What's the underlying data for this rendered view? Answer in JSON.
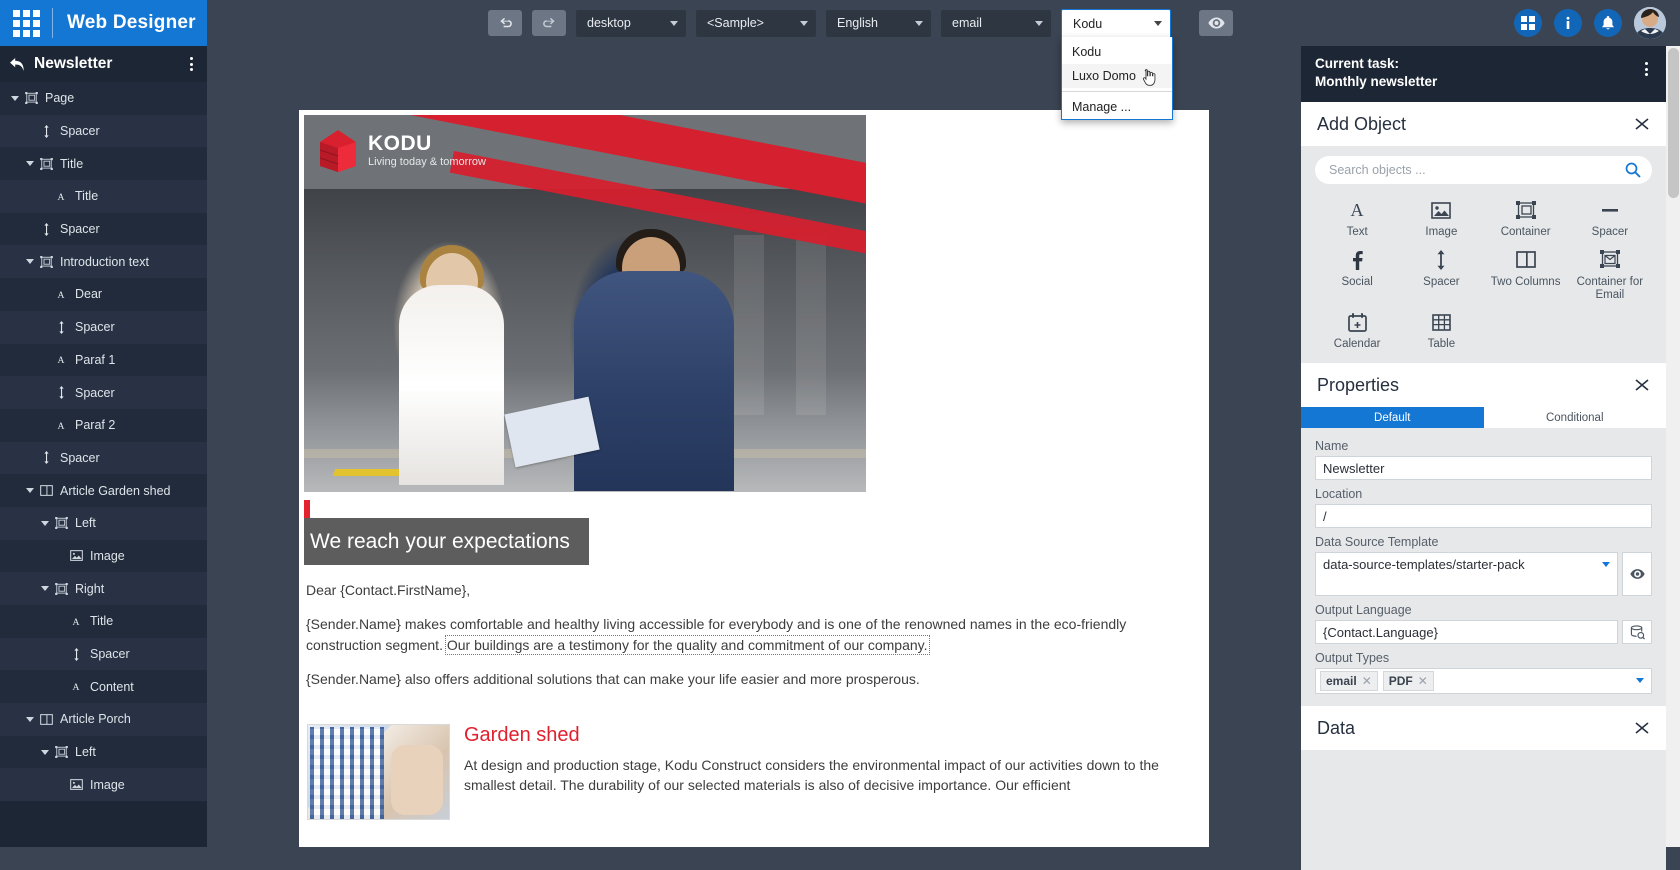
{
  "app": {
    "brand_title": "Web Designer",
    "waffle_icon": "apps-grid-icon",
    "header_icons": [
      "apps-icon",
      "info-icon",
      "notifications-bell-icon",
      "user-avatar"
    ]
  },
  "toolbar": {
    "undo_icon": "undo-icon",
    "redo_icon": "redo-icon",
    "device": {
      "label": "desktop",
      "icon": "chevron-down-icon"
    },
    "sample": {
      "label": "<Sample>",
      "icon": "chevron-down-icon"
    },
    "language": {
      "label": "English",
      "icon": "chevron-down-icon"
    },
    "output": {
      "label": "email",
      "icon": "chevron-down-icon"
    },
    "brand_select": {
      "label": "Kodu",
      "open": true,
      "items": [
        {
          "label": "Kodu",
          "hover": false
        },
        {
          "label": "Luxo Domo",
          "hover": true
        },
        {
          "label": "Manage ...",
          "hover": false
        }
      ]
    },
    "preview_icon": "eye-icon"
  },
  "left_panel": {
    "back_icon": "back-arrow-icon",
    "title": "Newsletter",
    "kebab_icon": "more-vertical-icon",
    "tree": [
      {
        "label": "Page",
        "indent": 0,
        "icon": "container-icon",
        "expandable": true
      },
      {
        "label": "Spacer",
        "indent": 1,
        "icon": "spacer-icon",
        "expandable": false
      },
      {
        "label": "Title",
        "indent": 1,
        "icon": "container-icon",
        "expandable": true
      },
      {
        "label": "Title",
        "indent": 2,
        "icon": "text-icon",
        "expandable": false
      },
      {
        "label": "Spacer",
        "indent": 1,
        "icon": "spacer-icon",
        "expandable": false
      },
      {
        "label": "Introduction text",
        "indent": 1,
        "icon": "container-icon",
        "expandable": true
      },
      {
        "label": "Dear",
        "indent": 2,
        "icon": "text-icon",
        "expandable": false
      },
      {
        "label": "Spacer",
        "indent": 2,
        "icon": "spacer-icon",
        "expandable": false
      },
      {
        "label": "Paraf 1",
        "indent": 2,
        "icon": "text-icon",
        "expandable": false
      },
      {
        "label": "Spacer",
        "indent": 2,
        "icon": "spacer-icon",
        "expandable": false
      },
      {
        "label": "Paraf 2",
        "indent": 2,
        "icon": "text-icon",
        "expandable": false
      },
      {
        "label": "Spacer",
        "indent": 1,
        "icon": "spacer-icon",
        "expandable": false
      },
      {
        "label": "Article Garden shed",
        "indent": 1,
        "icon": "two-columns-icon",
        "expandable": true
      },
      {
        "label": "Left",
        "indent": 2,
        "icon": "container-icon",
        "expandable": true
      },
      {
        "label": "Image",
        "indent": 3,
        "icon": "image-icon",
        "expandable": false
      },
      {
        "label": "Right",
        "indent": 2,
        "icon": "container-icon",
        "expandable": true
      },
      {
        "label": "Title",
        "indent": 3,
        "icon": "text-icon",
        "expandable": false
      },
      {
        "label": "Spacer",
        "indent": 3,
        "icon": "spacer-icon",
        "expandable": false
      },
      {
        "label": "Content",
        "indent": 3,
        "icon": "text-icon",
        "expandable": false
      },
      {
        "label": "Article Porch",
        "indent": 1,
        "icon": "two-columns-icon",
        "expandable": true
      },
      {
        "label": "Left",
        "indent": 2,
        "icon": "container-icon",
        "expandable": true
      },
      {
        "label": "Image",
        "indent": 3,
        "icon": "image-icon",
        "expandable": false
      }
    ]
  },
  "canvas": {
    "logo": {
      "name": "KODU",
      "tagline": "Living today & tomorrow",
      "mark_icon": "kodu-cube-logo"
    },
    "hero_band": "We reach your expectations",
    "paragraphs": [
      {
        "text": "Dear {Contact.FirstName},",
        "selected": false
      },
      {
        "text": "{Sender.Name} makes comfortable and healthy living accessible for everybody and is one of the renowned names in the eco-friendly construction segment. ",
        "selected": false
      },
      {
        "text": "Our buildings are a testimony for the quality and commitment of our company.",
        "selected": true
      },
      {
        "text": "{Sender.Name} also offers additional solutions that can make your life easier and more prosperous.",
        "selected": false
      }
    ],
    "article": {
      "title": "Garden shed",
      "text": "At design and production stage, Kodu Construct considers the environmental impact of our activities down to the smallest detail. The durability of our selected materials is also of decisive importance. Our efficient"
    }
  },
  "right_panel": {
    "task_label": "Current task:",
    "task_name": "Monthly newsletter",
    "task_kebab_icon": "more-vertical-icon",
    "add_object": {
      "title": "Add Object",
      "collapse_icon": "chevron-collapse-icon",
      "search_placeholder": "Search objects ...",
      "search_value": "",
      "search_icon": "search-icon",
      "objects": [
        {
          "label": "Text",
          "icon": "text-icon"
        },
        {
          "label": "Image",
          "icon": "image-icon"
        },
        {
          "label": "Container",
          "icon": "container-icon"
        },
        {
          "label": "Spacer",
          "icon": "spacer-line-icon"
        },
        {
          "label": "Social",
          "icon": "facebook-icon"
        },
        {
          "label": "Spacer",
          "icon": "spacer-arrow-icon"
        },
        {
          "label": "Two Columns",
          "icon": "two-columns-icon"
        },
        {
          "label": "Container for Email",
          "icon": "container-email-icon"
        },
        {
          "label": "Calendar",
          "icon": "calendar-add-icon"
        },
        {
          "label": "Table",
          "icon": "table-icon"
        }
      ]
    },
    "properties": {
      "title": "Properties",
      "collapse_icon": "chevron-collapse-icon",
      "tabs": [
        {
          "label": "Default",
          "active": true
        },
        {
          "label": "Conditional",
          "active": false
        }
      ],
      "fields": [
        {
          "label": "Name",
          "value": "Newsletter"
        },
        {
          "label": "Location",
          "value": "/"
        }
      ],
      "data_source": {
        "label": "Data Source Template",
        "value": "data-source-templates/starter-pack",
        "caret_icon": "chevron-down-icon",
        "button_icon": "eye-icon"
      },
      "output_language": {
        "label": "Output Language",
        "value": "{Contact.Language}",
        "button_icon": "database-search-icon"
      },
      "output_types": {
        "label": "Output Types",
        "chips": [
          "email",
          "PDF"
        ],
        "chip_remove_icon": "close-icon",
        "caret_icon": "chevron-down-icon"
      }
    },
    "data_section": {
      "title": "Data",
      "collapse_icon": "chevron-collapse-icon"
    }
  },
  "colors": {
    "brand_blue": "#1477d4",
    "panel_dark": "#1d2635",
    "canvas_bg": "#3b4452",
    "accent_red": "#e0202e"
  }
}
